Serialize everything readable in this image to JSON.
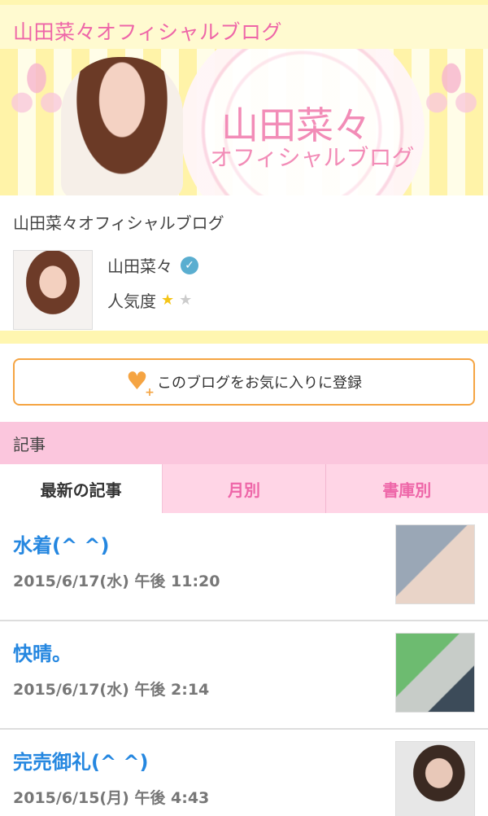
{
  "topbar": {
    "title": "山田菜々オフィシャルブログ"
  },
  "banner": {
    "title_line1": "山田菜々",
    "title_line2": "オフィシャルブログ"
  },
  "profile": {
    "blog_name": "山田菜々オフィシャルブログ",
    "author_name": "山田菜々",
    "verified_icon": "check-icon",
    "popularity_label": "人気度",
    "popularity_rating": 1,
    "popularity_max": 2
  },
  "favorite": {
    "icon": "heart-plus-icon",
    "label": "このブログをお気に入りに登録"
  },
  "section": {
    "heading": "記事",
    "tabs": [
      {
        "label": "最新の記事",
        "active": true
      },
      {
        "label": "月別",
        "active": false
      },
      {
        "label": "書庫別",
        "active": false
      }
    ]
  },
  "articles": [
    {
      "title": "水着(^ ^)",
      "date": "2015/6/17(水) 午後 11:20"
    },
    {
      "title": "快晴。",
      "date": "2015/6/17(水) 午後 2:14"
    },
    {
      "title": "完売御礼(^ ^)",
      "date": "2015/6/15(月) 午後 4:43"
    }
  ],
  "colors": {
    "accent_pink": "#ee66a8",
    "link_blue": "#2587e0",
    "favorite_orange": "#f5a442"
  }
}
